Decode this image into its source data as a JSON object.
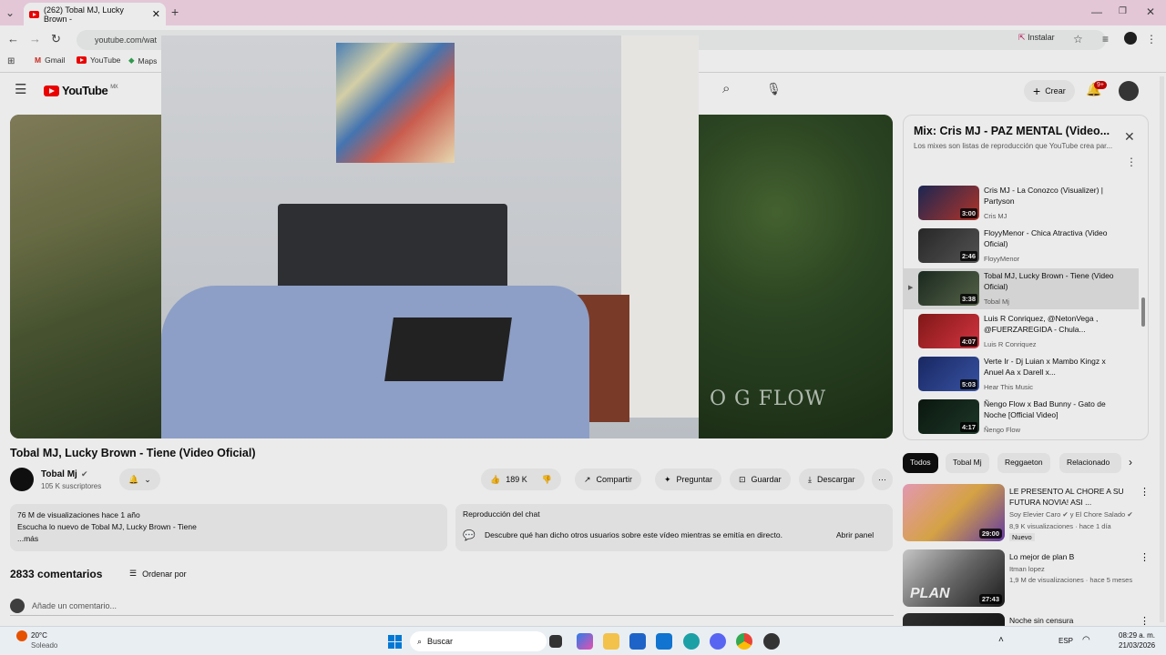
{
  "browser": {
    "tab_title": "(262) Tobal MJ, Lucky Brown -",
    "url": "youtube.com/wat",
    "install_label": "Instalar",
    "bookmarks": [
      "Gmail",
      "YouTube",
      "Maps"
    ]
  },
  "youtube": {
    "country_code": "MX",
    "create_label": "Crear",
    "notif_badge": "9+"
  },
  "video": {
    "overlay_text": "O G FLOW",
    "title": "Tobal MJ, Lucky Brown - Tiene (Video Oficial)",
    "channel": "Tobal Mj",
    "subscribers": "105 K suscriptores",
    "likes": "189 K",
    "share_label": "Compartir",
    "ask_label": "Preguntar",
    "save_label": "Guardar",
    "download_label": "Descargar"
  },
  "description": {
    "views_date": "76 M de visualizaciones  hace 1 año",
    "text": "Escucha lo nuevo de Tobal MJ, Lucky Brown - Tiene",
    "more": "...más"
  },
  "chat_replay": {
    "title": "Reproducción del chat",
    "text": "Descubre qué han dicho otros usuarios sobre este vídeo mientras se emitía en directo.",
    "open_label": "Abrir panel"
  },
  "comments": {
    "count": "2833 comentarios",
    "sort_label": "Ordenar por",
    "add_placeholder": "Añade un comentario..."
  },
  "mix": {
    "title": "Mix: Cris MJ - PAZ MENTAL (Video...",
    "subtitle": "Los mixes son listas de reproducción que YouTube crea par...",
    "items": [
      {
        "title": "Cris MJ - La Conozco (Visualizer) | Partyson",
        "channel": "Cris MJ",
        "duration": "3:00"
      },
      {
        "title": "FloyyMenor - Chica Atractiva (Video Oficial)",
        "channel": "FloyyMenor",
        "duration": "2:46"
      },
      {
        "title": "Tobal MJ, Lucky Brown - Tiene (Video Oficial)",
        "channel": "Tobal Mj",
        "duration": "3:38"
      },
      {
        "title": "Luis R Conriquez, @NetonVega , @FUERZAREGIDA - Chula...",
        "channel": "Luis R Conriquez",
        "duration": "4:07"
      },
      {
        "title": "Verte Ir - Dj Luian x Mambo Kingz x Anuel Aa x Darell x...",
        "channel": "Hear This Music",
        "duration": "5:03"
      },
      {
        "title": "Ñengo Flow x Bad Bunny - Gato de Noche [Official Video]",
        "channel": "Ñengo Flow",
        "duration": "4:17"
      }
    ]
  },
  "chips": [
    "Todos",
    "Tobal Mj",
    "Reggaeton",
    "Relacionado"
  ],
  "recommendations": [
    {
      "title": "LE PRESENTO AL CHORE A SU FUTURA NOVIA! ASI ...",
      "channel": "Soy Elevier Caro",
      "channel2": "y El Chore Salado",
      "meta": "8,9 K visualizaciones · hace 1 día",
      "badge": "Nuevo",
      "duration": "29:00"
    },
    {
      "title": "Lo mejor de plan B",
      "channel": "Itman lopez",
      "meta": "1,9 M de visualizaciones · hace 5 meses",
      "duration": "27:43",
      "thumb_text": "PLAN"
    },
    {
      "title": "Noche sin censura"
    }
  ],
  "taskbar": {
    "temp": "20°C",
    "weather": "Soleado",
    "search_label": "Buscar",
    "lang": "ESP",
    "time": "08:29 a. m.",
    "date": "21/03/2026"
  }
}
